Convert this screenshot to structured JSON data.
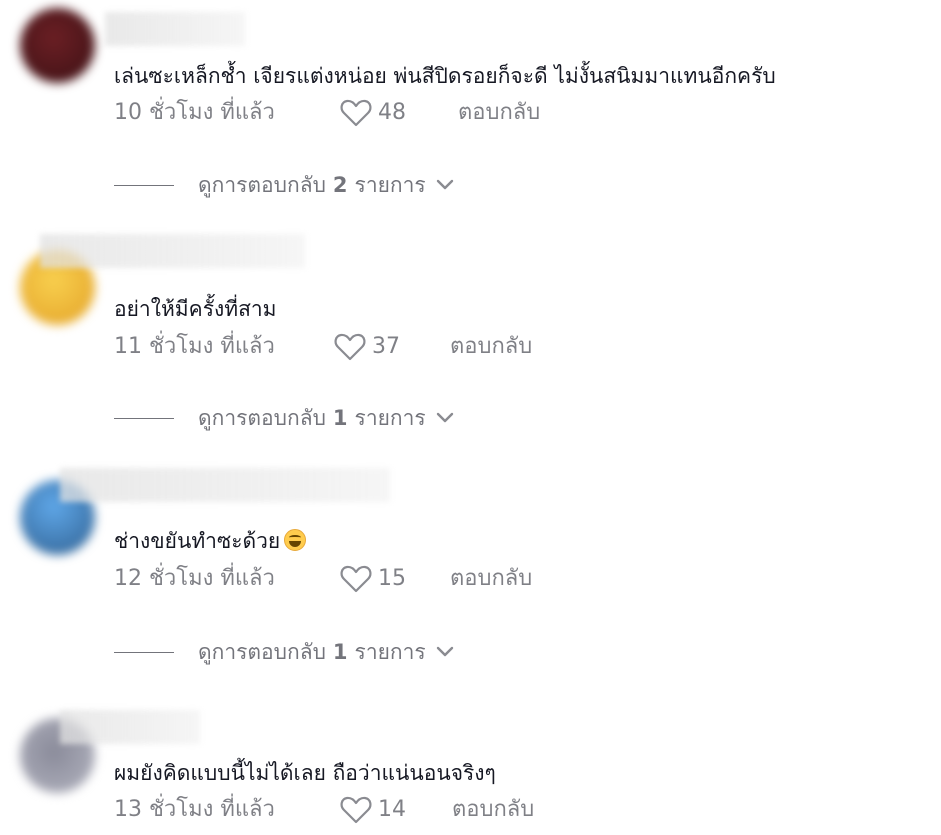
{
  "comments": [
    {
      "text": "เล่นซะเหล็กช้ำ เจียรแต่งหน่อย พ่นสีปิดรอยก็จะดี ไม่งั้นสนิมมาแทนอีกครับ",
      "time": "10 ชั่วโมง ที่แล้ว",
      "likes": "48",
      "reply_label": "ตอบกลับ",
      "view_replies": {
        "prefix": "ดูการตอบกลับ",
        "count": "2",
        "suffix": "รายการ"
      }
    },
    {
      "text": "อย่าให้มีครั้งที่สาม",
      "time": "11 ชั่วโมง ที่แล้ว",
      "likes": "37",
      "reply_label": "ตอบกลับ",
      "view_replies": {
        "prefix": "ดูการตอบกลับ",
        "count": "1",
        "suffix": "รายการ"
      }
    },
    {
      "text": "ช่างขยันทำซะด้วย",
      "emoji": "face-with-tears-of-joy",
      "time": "12 ชั่วโมง ที่แล้ว",
      "likes": "15",
      "reply_label": "ตอบกลับ",
      "view_replies": {
        "prefix": "ดูการตอบกลับ",
        "count": "1",
        "suffix": "รายการ"
      }
    },
    {
      "text": "ผมยังคิดแบบนี้ไม่ได้เลย ถือว่าแน่นอนจริงๆ",
      "time": "13 ชั่วโมง ที่แล้ว",
      "likes": "14",
      "reply_label": "ตอบกลับ"
    }
  ],
  "icons": {
    "like": "heart-outline-icon",
    "expand": "chevron-down-icon"
  },
  "colors": {
    "text": "#161823",
    "meta": "#8a8b91",
    "avatar_1": "#5a1a1e",
    "avatar_2": "#f2b636",
    "avatar_3": "#5b9bd5",
    "avatar_4": "#7e7f8c"
  }
}
